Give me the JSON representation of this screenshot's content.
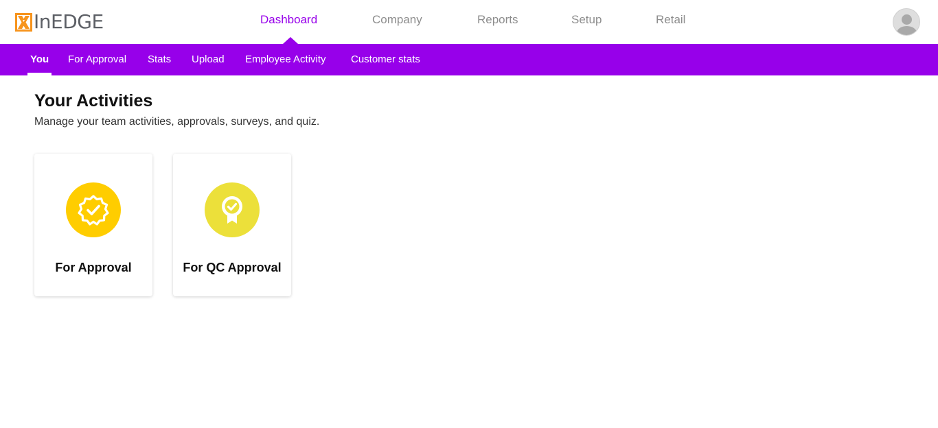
{
  "brand": {
    "name": "InEDGE",
    "logo_icon": "inedge-x-mark",
    "colors": {
      "primary": "#9700ea",
      "logo_orange": "#f7941d",
      "logo_grey": "#5d6066"
    }
  },
  "topnav": {
    "items": [
      {
        "label": "Dashboard",
        "active": true
      },
      {
        "label": "Company",
        "active": false
      },
      {
        "label": "Reports",
        "active": false
      },
      {
        "label": "Setup",
        "active": false
      },
      {
        "label": "Retail",
        "active": false
      }
    ],
    "avatar_icon": "user-avatar-icon"
  },
  "subnav": {
    "items": [
      {
        "label": "You",
        "active": true
      },
      {
        "label": "For Approval",
        "active": false
      },
      {
        "label": "Stats",
        "active": false
      },
      {
        "label": "Upload",
        "active": false
      },
      {
        "label": "Employee Activity",
        "active": false
      },
      {
        "label": "Customer stats",
        "active": false
      }
    ]
  },
  "main": {
    "title": "Your Activities",
    "subtitle": "Manage your team activities, approvals, surveys, and quiz.",
    "cards": [
      {
        "label": "For Approval",
        "icon": "verified-badge-icon",
        "icon_color": "#ffcd00"
      },
      {
        "label": "For QC Approval",
        "icon": "award-ribbon-icon",
        "icon_color": "#ece03a"
      }
    ]
  }
}
